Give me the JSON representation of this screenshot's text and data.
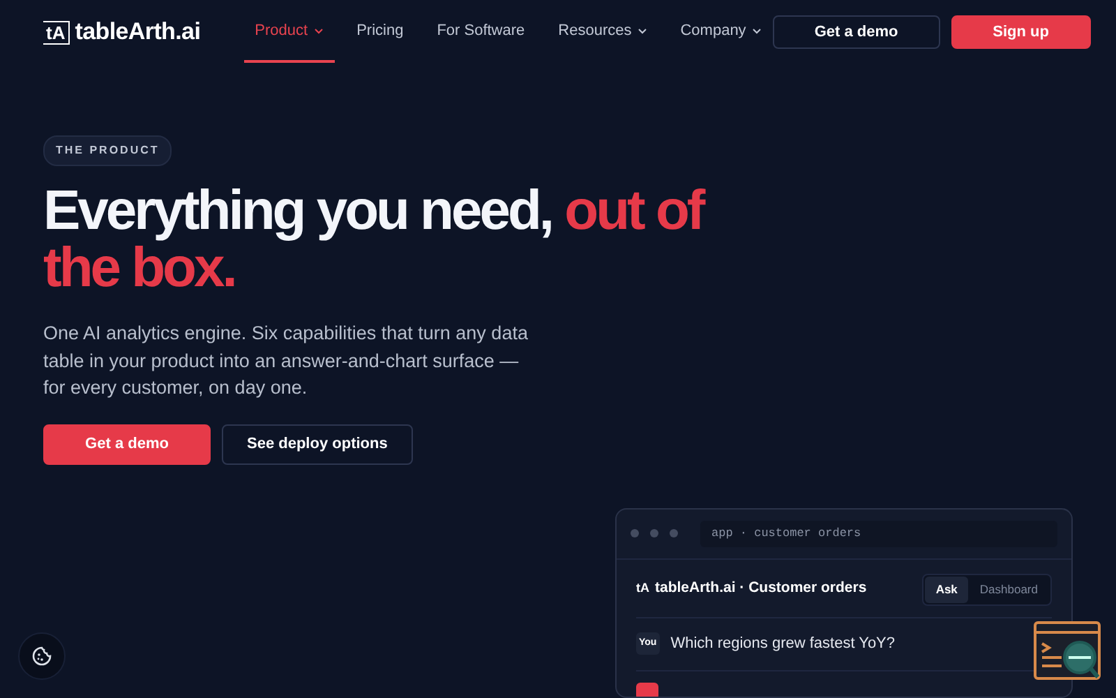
{
  "brand": {
    "name": "tableArth.ai",
    "mark": "tA"
  },
  "nav": [
    {
      "label": "Product",
      "selected": true,
      "dropdown": true
    },
    {
      "label": "Pricing",
      "selected": false,
      "dropdown": false
    },
    {
      "label": "For Software",
      "selected": false,
      "dropdown": false
    },
    {
      "label": "Resources",
      "selected": false,
      "dropdown": true
    },
    {
      "label": "Company",
      "selected": false,
      "dropdown": true
    }
  ],
  "header_buttons": [
    {
      "label": "Get a demo",
      "kind": "outline"
    },
    {
      "label": "Sign up",
      "kind": "primary"
    }
  ],
  "hero": {
    "eyebrow": "THE PRODUCT",
    "title": "Everything you need, ",
    "title_accent": "out of the box.",
    "lead": "One AI analytics engine. Six capabilities that turn any data table in your product into an answer-and-chart surface — for every customer, on day one.",
    "buttons": [
      {
        "label": "Get a demo",
        "kind": "primary"
      },
      {
        "label": "See deploy options",
        "kind": "outline"
      }
    ]
  },
  "app_preview": {
    "address": "app · customer orders",
    "mark": "tA",
    "title": "tableArth.ai · Customer orders",
    "tabs": [
      {
        "label": "Ask",
        "selected": true
      },
      {
        "label": "Dashboard",
        "selected": false
      }
    ],
    "message": {
      "sender": "You",
      "text": "Which regions grew fastest YoY?"
    }
  }
}
